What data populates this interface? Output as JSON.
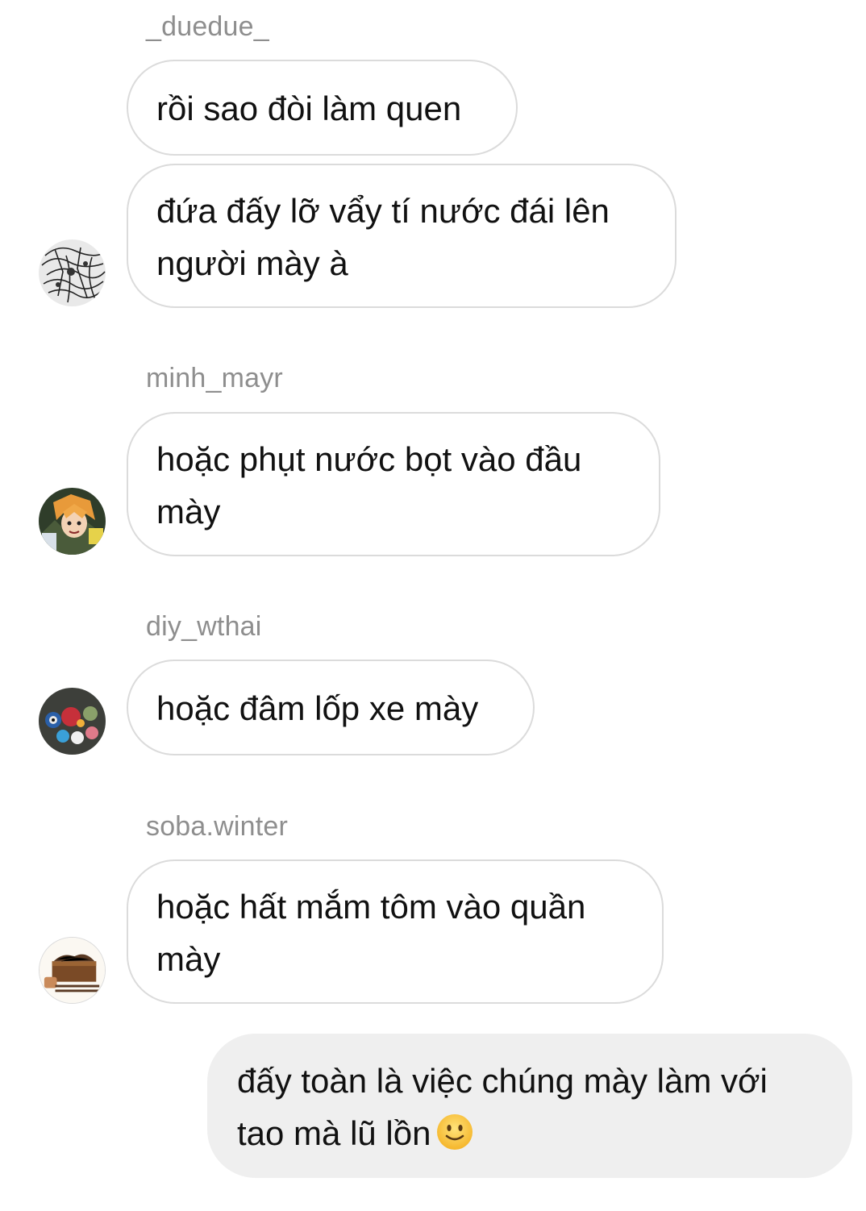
{
  "thread": [
    {
      "sender": "_duedue_",
      "messages": [
        "rồi sao đòi làm quen",
        "đứa đấy lỡ vẩy tí nước đái lên người mày à"
      ],
      "avatar_icon": "manga-sketch-avatar"
    },
    {
      "sender": "minh_mayr",
      "messages": [
        "hoặc phụt nước bọt vào đầu mày"
      ],
      "avatar_icon": "anime-character-avatar"
    },
    {
      "sender": "diy_wthai",
      "messages": [
        "hoặc đâm lốp xe mày"
      ],
      "avatar_icon": "colorful-beads-avatar"
    },
    {
      "sender": "soba.winter",
      "messages": [
        "hoặc hất mắm tôm vào quần mày"
      ],
      "avatar_icon": "soba-noodles-avatar"
    }
  ],
  "my_message": {
    "text": "đấy toàn là việc chúng mày làm với tao mà lũ lồn",
    "emoji": "slightly-smiling-face-emoji"
  },
  "colors": {
    "background": "#ffffff",
    "bubble_border": "#dbdbdb",
    "my_bubble": "#efefef",
    "sender_text": "#8e8e8e",
    "message_text": "#111111"
  }
}
